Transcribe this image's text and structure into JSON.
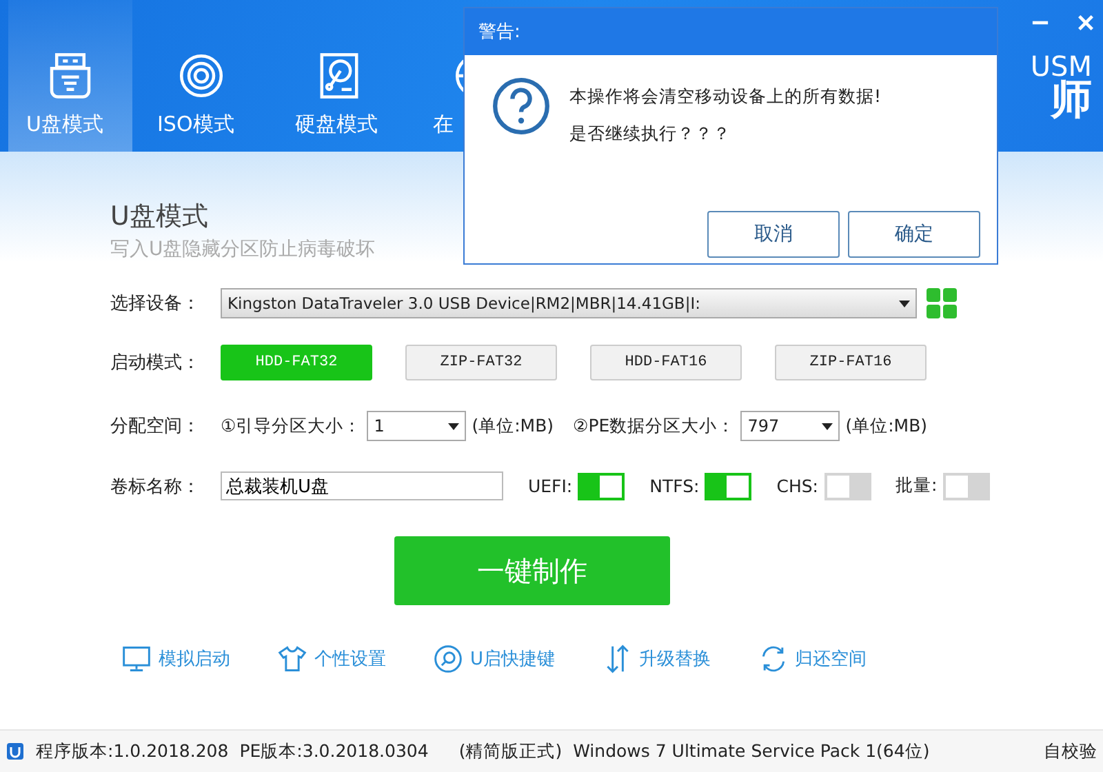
{
  "tabs": [
    {
      "label": "U盘模式",
      "selected": true
    },
    {
      "label": "ISO模式",
      "selected": false
    },
    {
      "label": "硬盘模式",
      "selected": false
    },
    {
      "label": "在",
      "selected": false
    }
  ],
  "logo": {
    "top": "USM",
    "bottom": "师"
  },
  "heading": {
    "title": "U盘模式",
    "subtitle": "写入U盘隐藏分区防止病毒破坏"
  },
  "device": {
    "label": "选择设备：",
    "value": "Kingston DataTraveler 3.0 USB Device|RM2|MBR|14.41GB|I:"
  },
  "boot": {
    "label": "启动模式：",
    "modes": [
      {
        "label": "HDD-FAT32",
        "selected": true
      },
      {
        "label": "ZIP-FAT32",
        "selected": false
      },
      {
        "label": "HDD-FAT16",
        "selected": false
      },
      {
        "label": "ZIP-FAT16",
        "selected": false
      }
    ]
  },
  "partition": {
    "label": "分配空间：",
    "boot_label": "①引导分区大小：",
    "boot_value": "1",
    "boot_unit": "(单位:MB)",
    "pe_label": "②PE数据分区大小：",
    "pe_value": "797",
    "pe_unit": "(单位:MB)"
  },
  "volume": {
    "label": "卷标名称：",
    "value": "总裁装机U盘"
  },
  "switches": [
    {
      "label": "UEFI:",
      "on": true
    },
    {
      "label": "NTFS:",
      "on": true
    },
    {
      "label": "CHS:",
      "on": false
    },
    {
      "label": "批量:",
      "on": false
    }
  ],
  "make_button": "一键制作",
  "links": [
    {
      "label": "模拟启动"
    },
    {
      "label": "个性设置"
    },
    {
      "label": "U启快捷键"
    },
    {
      "label": "升级替换"
    },
    {
      "label": "归还空间"
    }
  ],
  "status_bar": {
    "program_version": "程序版本:1.0.2018.208",
    "pe_version": "PE版本:3.0.2018.0304",
    "edition": "(精简版正式)",
    "os": "Windows 7 Ultimate Service Pack 1(64位)",
    "check": "自校验"
  },
  "dialog": {
    "title": "警告:",
    "message": "本操作将会清空移动设备上的所有数据!",
    "question": "是否继续执行？？？",
    "buttons": [
      "取消",
      "确定"
    ]
  }
}
